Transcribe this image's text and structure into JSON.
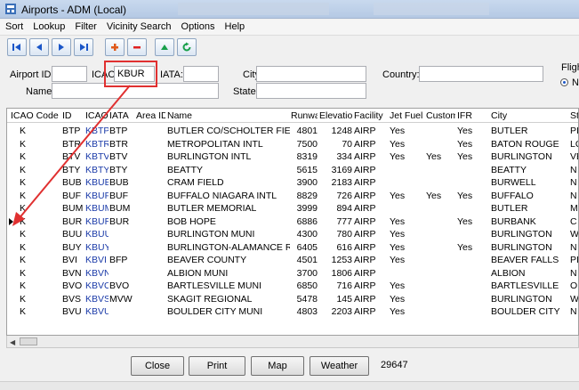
{
  "window": {
    "title": "Airports - ADM (Local)",
    "icon": "app-window-icon"
  },
  "menu": [
    "Sort",
    "Lookup",
    "Filter",
    "Vicinity Search",
    "Options",
    "Help"
  ],
  "toolbar": {
    "buttons": [
      {
        "name": "first-record-icon",
        "color": "#1a56c8"
      },
      {
        "name": "prev-record-icon",
        "color": "#1a56c8"
      },
      {
        "name": "next-record-icon",
        "color": "#1a56c8"
      },
      {
        "name": "last-record-icon",
        "color": "#1a56c8"
      },
      {
        "name": "add-record-icon",
        "color": "#e05a1a"
      },
      {
        "name": "delete-record-icon",
        "color": "#e02020"
      },
      {
        "name": "post-record-icon",
        "color": "#18a04a"
      },
      {
        "name": "refresh-icon",
        "color": "#18a04a"
      }
    ]
  },
  "search": {
    "airport_id_label": "Airport ID:",
    "airport_id_value": "",
    "icao_label_pre": "ICA",
    "icao_label_post": "O:",
    "icao_value": "KBUR",
    "iata_label": "IATA:",
    "iata_value": "",
    "city_label": "City:",
    "city_value": "",
    "country_label": "Country:",
    "country_value": "",
    "name_label": "Name:",
    "name_value": "",
    "state_label": "State:",
    "state_value": "",
    "flight_label": "Fligh",
    "radio_label": "N"
  },
  "table": {
    "columns": [
      "ICAO Code",
      "ID",
      "ICAO",
      "IATA",
      "Area ID",
      "Name",
      "Runway",
      "Elevation",
      "Facility",
      "Jet Fuel",
      "Custom",
      "IFR",
      "City",
      "St"
    ],
    "selected_row": 8,
    "rows": [
      [
        "K",
        "BTP",
        "KBTP",
        "BTP",
        "",
        "BUTLER CO/SCHOLTER FIELD",
        "4801",
        "1248",
        "AIRP",
        "Yes",
        "",
        "Yes",
        "BUTLER",
        "PI"
      ],
      [
        "K",
        "BTR",
        "KBTR",
        "BTR",
        "",
        "METROPOLITAN INTL",
        "7500",
        "70",
        "AIRP",
        "Yes",
        "",
        "Yes",
        "BATON ROUGE",
        "LO"
      ],
      [
        "K",
        "BTV",
        "KBTV",
        "BTV",
        "",
        "BURLINGTON INTL",
        "8319",
        "334",
        "AIRP",
        "Yes",
        "Yes",
        "Yes",
        "BURLINGTON",
        "VE"
      ],
      [
        "K",
        "BTY",
        "KBTY",
        "BTY",
        "",
        "BEATTY",
        "5615",
        "3169",
        "AIRP",
        "",
        "",
        "",
        "BEATTY",
        "N"
      ],
      [
        "K",
        "BUB",
        "KBUB",
        "BUB",
        "",
        "CRAM FIELD",
        "3900",
        "2183",
        "AIRP",
        "",
        "",
        "",
        "BURWELL",
        "N"
      ],
      [
        "K",
        "BUF",
        "KBUF",
        "BUF",
        "",
        "BUFFALO NIAGARA INTL",
        "8829",
        "726",
        "AIRP",
        "Yes",
        "Yes",
        "Yes",
        "BUFFALO",
        "N"
      ],
      [
        "K",
        "BUM",
        "KBUM",
        "BUM",
        "",
        "BUTLER MEMORIAL",
        "3999",
        "894",
        "AIRP",
        "",
        "",
        "",
        "BUTLER",
        "M"
      ],
      [
        "K",
        "BUR",
        "KBUR",
        "BUR",
        "",
        "BOB HOPE",
        "6886",
        "777",
        "AIRP",
        "Yes",
        "",
        "Yes",
        "BURBANK",
        "C"
      ],
      [
        "K",
        "BUU",
        "KBUU",
        "",
        "",
        "BURLINGTON MUNI",
        "4300",
        "780",
        "AIRP",
        "Yes",
        "",
        "",
        "BURLINGTON",
        "W"
      ],
      [
        "K",
        "BUY",
        "KBUY",
        "",
        "",
        "BURLINGTON-ALAMANCE RGNL",
        "6405",
        "616",
        "AIRP",
        "Yes",
        "",
        "Yes",
        "BURLINGTON",
        "N"
      ],
      [
        "K",
        "BVI",
        "KBVI",
        "BFP",
        "",
        "BEAVER COUNTY",
        "4501",
        "1253",
        "AIRP",
        "Yes",
        "",
        "",
        "BEAVER FALLS",
        "PI"
      ],
      [
        "K",
        "BVN",
        "KBVN",
        "",
        "",
        "ALBION MUNI",
        "3700",
        "1806",
        "AIRP",
        "",
        "",
        "",
        "ALBION",
        "N"
      ],
      [
        "K",
        "BVO",
        "KBVO",
        "BVO",
        "",
        "BARTLESVILLE MUNI",
        "6850",
        "716",
        "AIRP",
        "Yes",
        "",
        "",
        "BARTLESVILLE",
        "O"
      ],
      [
        "K",
        "BVS",
        "KBVS",
        "MVW",
        "",
        "SKAGIT REGIONAL",
        "5478",
        "145",
        "AIRP",
        "Yes",
        "",
        "",
        "BURLINGTON",
        "W"
      ],
      [
        "K",
        "BVU",
        "KBVU",
        "",
        "",
        "BOULDER CITY MUNI",
        "4803",
        "2203",
        "AIRP",
        "Yes",
        "",
        "",
        "BOULDER CITY",
        "N"
      ]
    ]
  },
  "buttons": {
    "close": "Close",
    "print": "Print",
    "map": "Map",
    "weather": "Weather"
  },
  "record_count": "29647",
  "colors": {
    "highlight": "#e03030",
    "icao_link": "#1a3aa8"
  }
}
